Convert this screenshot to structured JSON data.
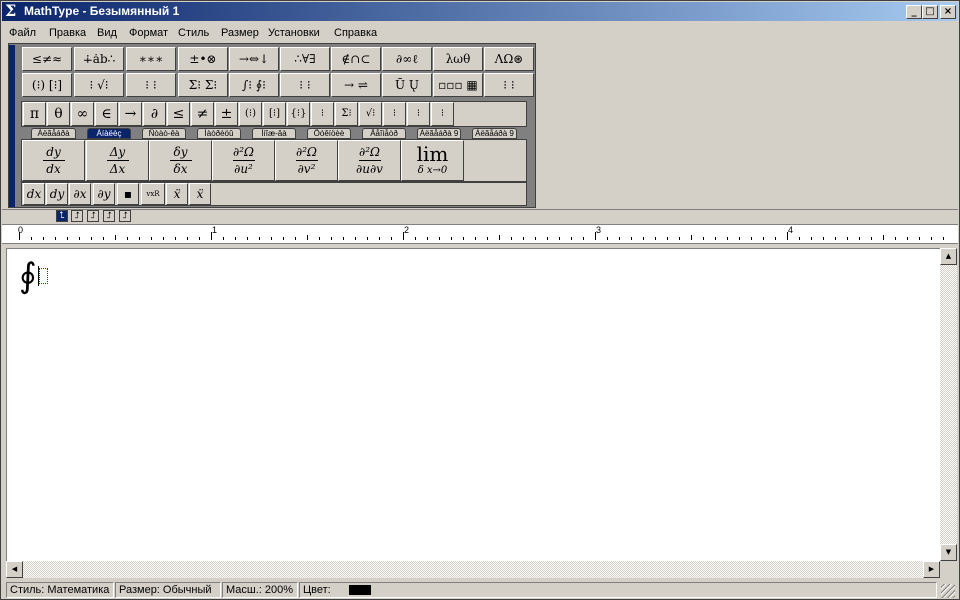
{
  "window": {
    "title": "MathType - Безымянный 1",
    "minimize": "_",
    "maximize": "□",
    "close": "×"
  },
  "menu": [
    "Файл",
    "Правка",
    "Вид",
    "Формат",
    "Стиль",
    "Размер",
    "Установки",
    "Справка"
  ],
  "toolbar_row1": [
    "≤≠≈",
    "∔ȧb∴",
    "∗∗∗",
    "±•⊗",
    "→⇔↓",
    "∴∀∃",
    "∉∩⊂",
    "∂∞ℓ",
    "λωθ",
    "ΛΩ⊛"
  ],
  "toolbar_row2": [
    "(⁝) [⁝]",
    "⁝ √⁝",
    "⁝ ⁝",
    "Σ⁝ Σ⁝",
    "∫⁝ ∮⁝",
    "⁝ ⁝",
    "→ ⇌",
    "Ū Ų",
    "▫▫▫ ▦"
  ],
  "symbol_bar": [
    "π",
    "θ",
    "∞",
    "∈",
    "→",
    "∂",
    "≤",
    "≠",
    "±",
    "(⁝)",
    "[⁝]",
    "{⁝}",
    "⁝",
    "Σ⁝",
    "√⁝",
    "⁝",
    "⁝",
    "⁝"
  ],
  "tabs": [
    "Àëãåáðà",
    "Àíàëèç",
    "Ñòàò-êà",
    "Ìàòðèöû",
    "Ìíîæ-âà",
    "Ôóêíöèè",
    "Äåîìåòð",
    "Àëãåáðà 9",
    "Àëãåáðà 9"
  ],
  "active_tab_index": 1,
  "templates": [
    {
      "num": "dy",
      "den": "dx"
    },
    {
      "num": "Δy",
      "den": "Δx"
    },
    {
      "num": "δy",
      "den": "δx"
    },
    {
      "num": "∂²Ω",
      "den": "∂u²"
    },
    {
      "num": "∂²Ω",
      "den": "∂v²"
    },
    {
      "num": "∂²Ω",
      "den": "∂u∂v"
    }
  ],
  "limit_template": {
    "main": "lim",
    "sub": "δ x→0"
  },
  "small_row": [
    "dx",
    "dy",
    "∂x",
    "∂y",
    "▪",
    "vxR",
    "ẍ",
    "ẍ"
  ],
  "alignment": [
    "⮤",
    "⮥",
    "⮥",
    "⮥",
    "⮥"
  ],
  "ruler": [
    "0",
    "1",
    "2",
    "3",
    "4"
  ],
  "formula": {
    "symbol": "∮"
  },
  "status": {
    "style": "Стиль: Математика",
    "size": "Размер: Обычный",
    "zoom": "Масш.: 200%",
    "color_label": "Цвет:",
    "color_value": "#000000"
  }
}
